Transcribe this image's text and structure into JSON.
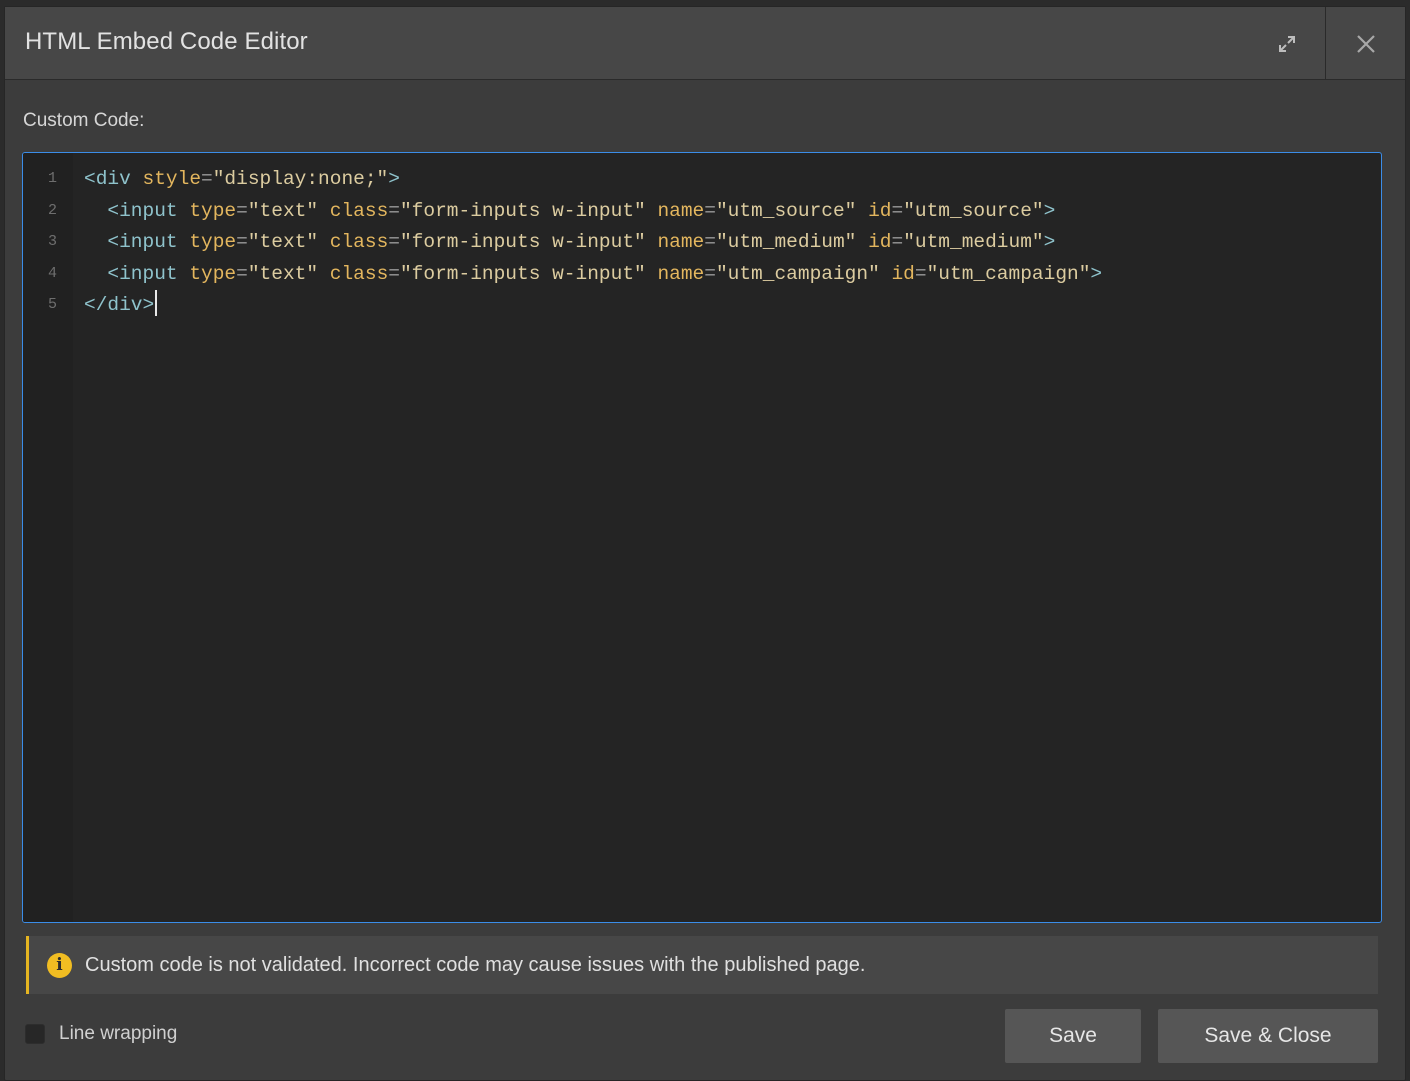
{
  "dialog": {
    "title": "HTML Embed Code Editor",
    "expand_icon": "expand-arrows-icon",
    "close_icon": "close-icon"
  },
  "editor": {
    "label": "Custom Code:",
    "lines": [
      {
        "num": "1",
        "tokens": [
          {
            "t": "tag",
            "v": "<div "
          },
          {
            "t": "attr",
            "v": "style"
          },
          {
            "t": "eq",
            "v": "="
          },
          {
            "t": "val",
            "v": "\"display:none;\""
          },
          {
            "t": "tag",
            "v": ">"
          }
        ]
      },
      {
        "num": "2",
        "tokens": [
          {
            "t": "tag",
            "v": "  <input "
          },
          {
            "t": "attr",
            "v": "type"
          },
          {
            "t": "eq",
            "v": "="
          },
          {
            "t": "val",
            "v": "\"text\" "
          },
          {
            "t": "attr",
            "v": "class"
          },
          {
            "t": "eq",
            "v": "="
          },
          {
            "t": "val",
            "v": "\"form-inputs w-input\" "
          },
          {
            "t": "attr",
            "v": "name"
          },
          {
            "t": "eq",
            "v": "="
          },
          {
            "t": "val",
            "v": "\"utm_source\" "
          },
          {
            "t": "attr",
            "v": "id"
          },
          {
            "t": "eq",
            "v": "="
          },
          {
            "t": "val",
            "v": "\"utm_source\""
          },
          {
            "t": "tag",
            "v": ">"
          }
        ]
      },
      {
        "num": "3",
        "tokens": [
          {
            "t": "tag",
            "v": "  <input "
          },
          {
            "t": "attr",
            "v": "type"
          },
          {
            "t": "eq",
            "v": "="
          },
          {
            "t": "val",
            "v": "\"text\" "
          },
          {
            "t": "attr",
            "v": "class"
          },
          {
            "t": "eq",
            "v": "="
          },
          {
            "t": "val",
            "v": "\"form-inputs w-input\" "
          },
          {
            "t": "attr",
            "v": "name"
          },
          {
            "t": "eq",
            "v": "="
          },
          {
            "t": "val",
            "v": "\"utm_medium\" "
          },
          {
            "t": "attr",
            "v": "id"
          },
          {
            "t": "eq",
            "v": "="
          },
          {
            "t": "val",
            "v": "\"utm_medium\""
          },
          {
            "t": "tag",
            "v": ">"
          }
        ]
      },
      {
        "num": "4",
        "tokens": [
          {
            "t": "tag",
            "v": "  <input "
          },
          {
            "t": "attr",
            "v": "type"
          },
          {
            "t": "eq",
            "v": "="
          },
          {
            "t": "val",
            "v": "\"text\" "
          },
          {
            "t": "attr",
            "v": "class"
          },
          {
            "t": "eq",
            "v": "="
          },
          {
            "t": "val",
            "v": "\"form-inputs w-input\" "
          },
          {
            "t": "attr",
            "v": "name"
          },
          {
            "t": "eq",
            "v": "="
          },
          {
            "t": "val",
            "v": "\"utm_campaign\" "
          },
          {
            "t": "attr",
            "v": "id"
          },
          {
            "t": "eq",
            "v": "="
          },
          {
            "t": "val",
            "v": "\"utm_campaign\""
          },
          {
            "t": "tag",
            "v": ">"
          }
        ]
      },
      {
        "num": "5",
        "tokens": [
          {
            "t": "tag",
            "v": "</div>"
          }
        ],
        "cursor": true
      }
    ]
  },
  "warning": {
    "icon": "info-icon",
    "icon_glyph": "i",
    "text": "Custom code is not validated. Incorrect code may cause issues with the published page.",
    "accent_color": "#e5b521"
  },
  "footer": {
    "line_wrapping_label": "Line wrapping",
    "line_wrapping_checked": false,
    "save_label": "Save",
    "save_close_label": "Save & Close"
  },
  "colors": {
    "focus_border": "#3b8de8",
    "tag": "#8fc3cc",
    "attribute": "#e3b65e",
    "string": "#dccca0"
  }
}
